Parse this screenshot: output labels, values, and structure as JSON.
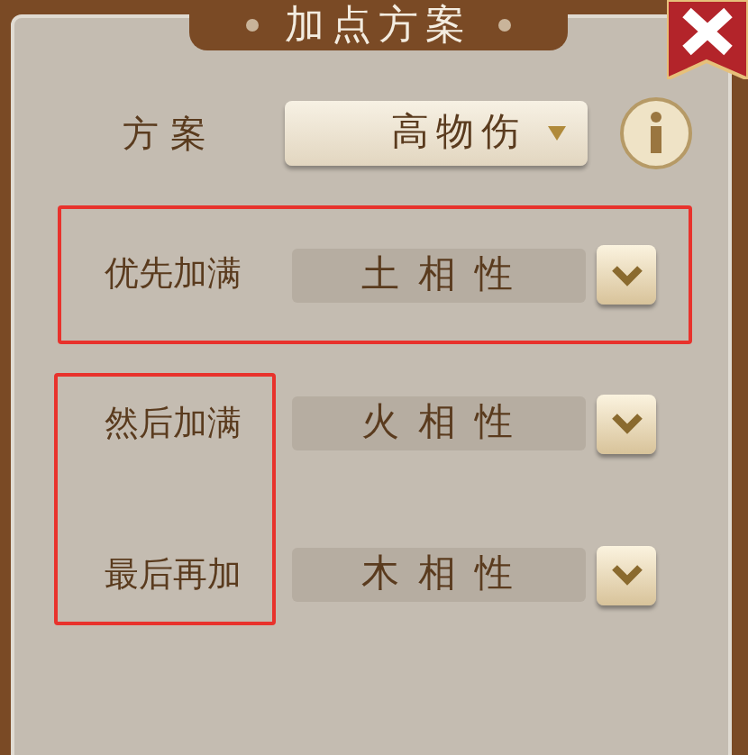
{
  "window": {
    "title": "加点方案"
  },
  "scheme": {
    "label": "方 案",
    "value": "高物伤"
  },
  "sections": [
    {
      "kind": "whole",
      "rows": [
        {
          "label": "优先加满",
          "value": "土 相 性"
        }
      ]
    },
    {
      "kind": "labels",
      "rows": [
        {
          "label": "然后加满",
          "value": "火 相 性"
        },
        {
          "label": "最后再加",
          "value": "木 相 性"
        }
      ]
    }
  ]
}
